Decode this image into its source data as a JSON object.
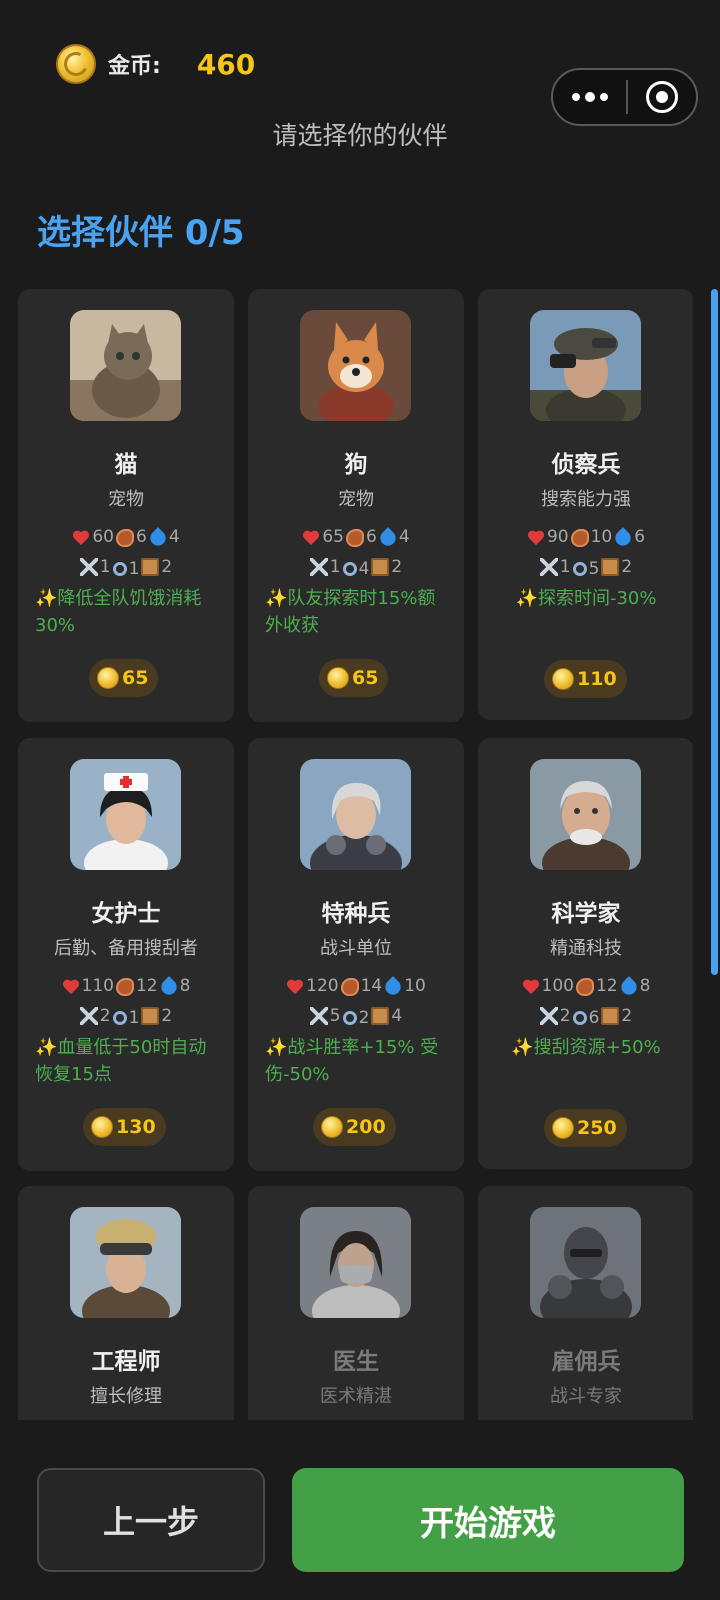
{
  "header": {
    "coin_label": "金币:",
    "coin_value": "460",
    "subtitle": "请选择你的伙伴",
    "section_title": "选择伙伴 0/5"
  },
  "companions": [
    {
      "name": "猫",
      "role": "宠物",
      "hp": "60",
      "food": "6",
      "water": "4",
      "atk": "1",
      "search": "1",
      "bag": "2",
      "skill": "✨降低全队饥饿消耗30%",
      "price": "65",
      "avatar_icon": "cat-avatar"
    },
    {
      "name": "狗",
      "role": "宠物",
      "hp": "65",
      "food": "6",
      "water": "4",
      "atk": "1",
      "search": "4",
      "bag": "2",
      "skill": "✨队友探索时15%额外收获",
      "price": "65",
      "avatar_icon": "dog-avatar"
    },
    {
      "name": "侦察兵",
      "role": "搜索能力强",
      "hp": "90",
      "food": "10",
      "water": "6",
      "atk": "1",
      "search": "5",
      "bag": "2",
      "skill": "✨探索时间-30%",
      "price": "110",
      "avatar_icon": "scout-avatar"
    },
    {
      "name": "女护士",
      "role": "后勤、备用搜刮者",
      "hp": "110",
      "food": "12",
      "water": "8",
      "atk": "2",
      "search": "1",
      "bag": "2",
      "skill": "✨血量低于50时自动恢复15点",
      "price": "130",
      "avatar_icon": "nurse-avatar"
    },
    {
      "name": "特种兵",
      "role": "战斗单位",
      "hp": "120",
      "food": "14",
      "water": "10",
      "atk": "5",
      "search": "2",
      "bag": "4",
      "skill": "✨战斗胜率+15% 受伤-50%",
      "price": "200",
      "avatar_icon": "soldier-avatar"
    },
    {
      "name": "科学家",
      "role": "精通科技",
      "hp": "100",
      "food": "12",
      "water": "8",
      "atk": "2",
      "search": "6",
      "bag": "2",
      "skill": "✨搜刮资源+50%",
      "price": "250",
      "avatar_icon": "scientist-avatar"
    },
    {
      "name": "工程师",
      "role": "擅长修理",
      "avatar_icon": "engineer-avatar"
    },
    {
      "name": "医生",
      "role": "医术精湛",
      "avatar_icon": "doctor-avatar"
    },
    {
      "name": "雇佣兵",
      "role": "战斗专家",
      "avatar_icon": "mercenary-avatar"
    }
  ],
  "footer": {
    "prev_label": "上一步",
    "start_label": "开始游戏"
  },
  "colors": {
    "background": "#1b1b1b",
    "card": "#2a2a2a",
    "accent_blue": "#4aa3f0",
    "gold": "#f5c518",
    "green": "#43a047",
    "skill_green": "#4caf50"
  }
}
